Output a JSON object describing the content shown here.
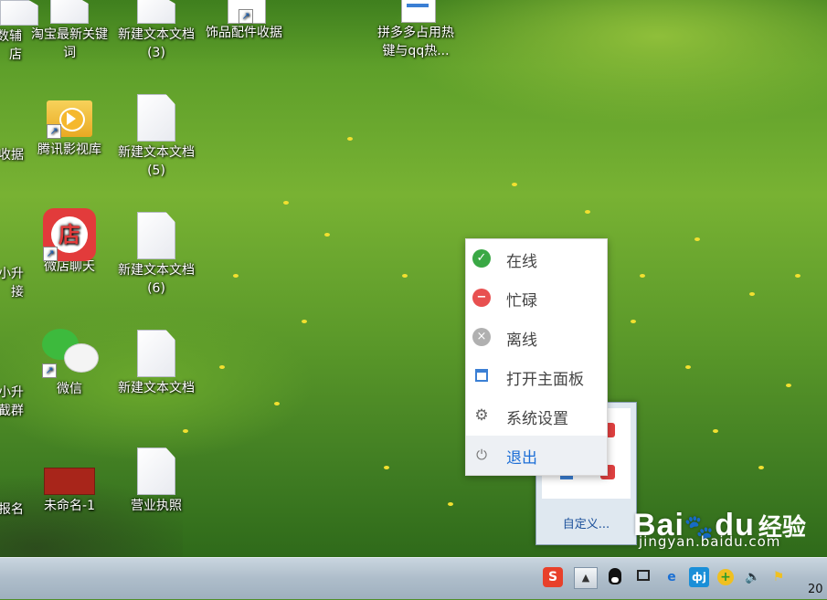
{
  "desktop": {
    "icons": [
      {
        "label": "数辅\n店"
      },
      {
        "label": "淘宝最新关键\n词"
      },
      {
        "label": "新建文本文档\n(3)"
      },
      {
        "label": "饰品配件收据"
      },
      {
        "label": "拼多多占用热\n键与qq热..."
      },
      {
        "label": "收据"
      },
      {
        "label": "腾讯影视库"
      },
      {
        "label": "新建文本文档\n(5)"
      },
      {
        "label": "小升\n接"
      },
      {
        "label": "微店聊天"
      },
      {
        "label": "新建文本文档\n(6)"
      },
      {
        "label": "小升\n截群"
      },
      {
        "label": "微信"
      },
      {
        "label": "新建文本文档"
      },
      {
        "label": "报名"
      },
      {
        "label": "未命名-1"
      },
      {
        "label": "营业执照"
      }
    ],
    "weidian_glyph": "店"
  },
  "status_menu": {
    "items": [
      {
        "label": "在线",
        "icon": "check-icon",
        "color": "#3aa845",
        "glyph": "✓"
      },
      {
        "label": "忙碌",
        "icon": "busy-icon",
        "color": "#e85050",
        "glyph": "−"
      },
      {
        "label": "离线",
        "icon": "offline-icon",
        "color": "#b0b0b0",
        "glyph": "×"
      },
      {
        "label": "打开主面板",
        "icon": "panel-icon",
        "color": "#3b7fd4",
        "glyph": "▭"
      },
      {
        "label": "系统设置",
        "icon": "gear-icon",
        "color": "#666666",
        "glyph": "⚙"
      },
      {
        "label": "退出",
        "icon": "power-icon",
        "color": "#777777",
        "glyph": "⏻"
      }
    ]
  },
  "tray_popup": {
    "customize_label": "自定义..."
  },
  "taskbar": {
    "clock_partial": "20"
  },
  "watermark": {
    "logo": "Bai",
    "logo2": "du",
    "jingyan": "经验",
    "url": "jingyan.baidu.com"
  }
}
